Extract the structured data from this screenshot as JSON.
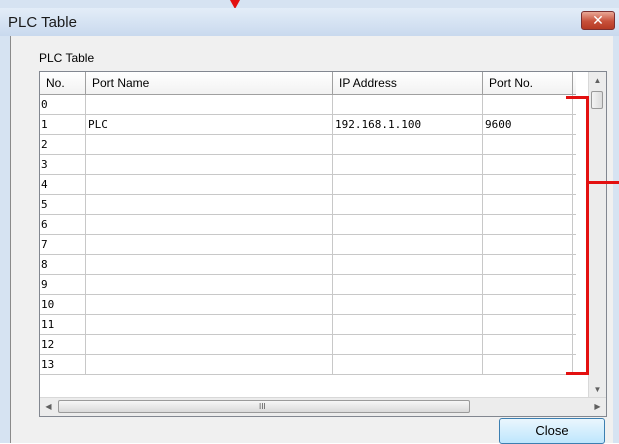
{
  "window": {
    "title": "PLC Table",
    "close_glyph": "✕"
  },
  "group": {
    "label": "PLC Table"
  },
  "table": {
    "columns": [
      "No.",
      "Port Name",
      "IP Address",
      "Port No."
    ],
    "rows": [
      [
        "0",
        "",
        "",
        ""
      ],
      [
        "1",
        "PLC",
        "192.168.1.100",
        "9600"
      ],
      [
        "2",
        "",
        "",
        ""
      ],
      [
        "3",
        "",
        "",
        ""
      ],
      [
        "4",
        "",
        "",
        ""
      ],
      [
        "5",
        "",
        "",
        ""
      ],
      [
        "6",
        "",
        "",
        ""
      ],
      [
        "7",
        "",
        "",
        ""
      ],
      [
        "8",
        "",
        "",
        ""
      ],
      [
        "9",
        "",
        "",
        ""
      ],
      [
        "10",
        "",
        "",
        ""
      ],
      [
        "11",
        "",
        "",
        ""
      ],
      [
        "12",
        "",
        "",
        ""
      ],
      [
        "13",
        "",
        "",
        ""
      ]
    ]
  },
  "scrollbars": {
    "up_glyph": "▲",
    "down_glyph": "▼",
    "left_glyph": "◀",
    "right_glyph": "▶",
    "grip_glyph": "III"
  },
  "buttons": {
    "close_label": "Close"
  },
  "colors": {
    "annotation": "#e31010"
  }
}
